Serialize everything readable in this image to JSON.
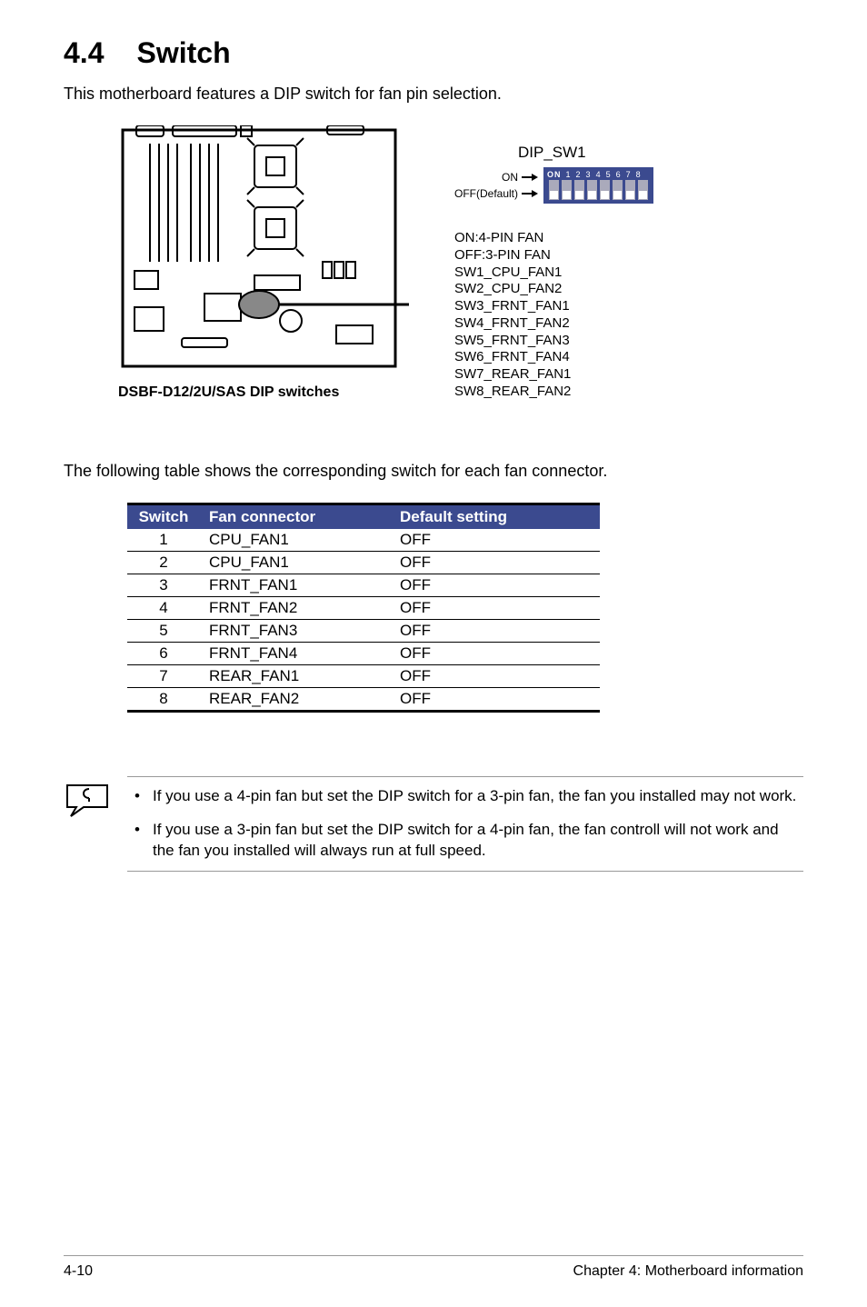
{
  "heading": {
    "number": "4.4",
    "title": "Switch"
  },
  "intro": "This motherboard features a DIP switch for fan pin selection.",
  "diagram": {
    "dip_title": "DIP_SW1",
    "on_label": "ON",
    "off_label": "OFF(Default)",
    "on_txt": "ON",
    "nums": [
      "1",
      "2",
      "3",
      "4",
      "5",
      "6",
      "7",
      "8"
    ],
    "legend": [
      "ON:4-PIN FAN",
      "OFF:3-PIN FAN",
      "SW1_CPU_FAN1",
      "SW2_CPU_FAN2",
      "SW3_FRNT_FAN1",
      "SW4_FRNT_FAN2",
      "SW5_FRNT_FAN3",
      "SW6_FRNT_FAN4",
      "SW7_REAR_FAN1",
      "SW8_REAR_FAN2"
    ],
    "caption": "DSBF-D12/2U/SAS DIP switches"
  },
  "table_intro": "The following table shows the corresponding switch for each fan connector.",
  "table": {
    "headers": {
      "c1": "Switch",
      "c2": "Fan connector",
      "c3": "Default setting"
    },
    "rows": [
      {
        "sw": "1",
        "fan": "CPU_FAN1",
        "def": "OFF"
      },
      {
        "sw": "2",
        "fan": "CPU_FAN1",
        "def": "OFF"
      },
      {
        "sw": "3",
        "fan": "FRNT_FAN1",
        "def": "OFF"
      },
      {
        "sw": "4",
        "fan": "FRNT_FAN2",
        "def": "OFF"
      },
      {
        "sw": "5",
        "fan": "FRNT_FAN3",
        "def": "OFF"
      },
      {
        "sw": "6",
        "fan": "FRNT_FAN4",
        "def": "OFF"
      },
      {
        "sw": "7",
        "fan": "REAR_FAN1",
        "def": "OFF"
      },
      {
        "sw": "8",
        "fan": "REAR_FAN2",
        "def": "OFF"
      }
    ]
  },
  "notes": [
    "If you use a 4-pin fan but set the DIP switch for a 3-pin fan, the fan you installed may not work.",
    "If you use a 3-pin fan but set the DIP switch for a 4-pin fan, the fan controll will not work and the fan you installed will always run at full speed."
  ],
  "footer": {
    "left": "4-10",
    "right": "Chapter 4: Motherboard information"
  }
}
